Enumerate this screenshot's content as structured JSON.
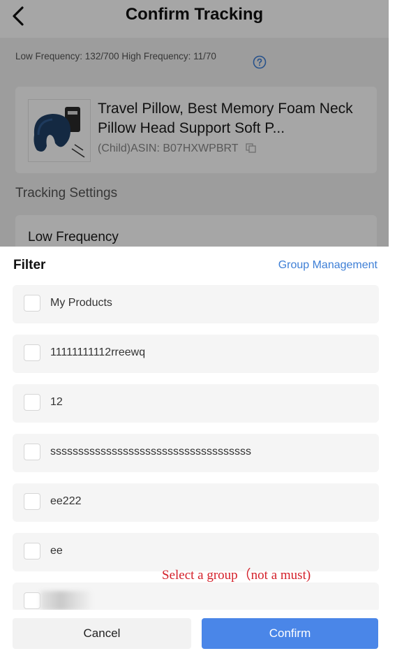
{
  "header": {
    "title": "Confirm Tracking",
    "back_icon": "chevron-left-icon"
  },
  "frequency_info": {
    "text": "Low Frequency: 132/700 High Frequency: 11/70",
    "help_icon": "question-circle-icon"
  },
  "product": {
    "title": "Travel Pillow, Best Memory Foam Neck Pillow Head Support Soft P...",
    "asin": "(Child)ASIN: B07HXWPBRT",
    "copy_icon": "copy-icon"
  },
  "tracking_settings": {
    "section_title": "Tracking Settings",
    "selected_option": "Low Frequency"
  },
  "filter_sheet": {
    "title": "Filter",
    "group_management_label": "Group Management",
    "groups": [
      {
        "label": "My Products",
        "checked": false
      },
      {
        "label": "11111111112rreewq",
        "checked": false
      },
      {
        "label": "12",
        "checked": false
      },
      {
        "label": "ssssssssssssssssssssssssssssssssssss",
        "checked": false
      },
      {
        "label": "ee222",
        "checked": false
      },
      {
        "label": "ee",
        "checked": false
      }
    ]
  },
  "annotation": {
    "text": "Select a group（not a must)",
    "color": "#d4202a"
  },
  "footer": {
    "cancel_label": "Cancel",
    "confirm_label": "Confirm"
  },
  "colors": {
    "accent": "#4a86e8",
    "link": "#3e7fd6"
  }
}
